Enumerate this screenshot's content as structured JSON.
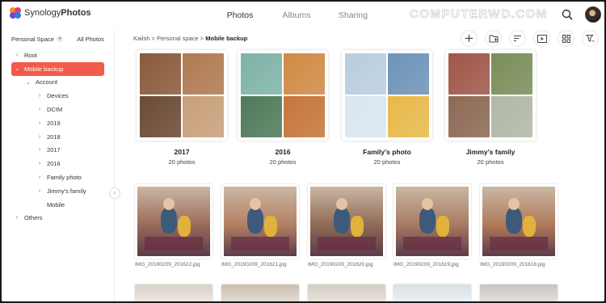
{
  "app": {
    "brand_light": "Synology",
    "brand_bold": "Photos"
  },
  "nav_tabs": [
    {
      "label": "Photos",
      "active": true
    },
    {
      "label": "Albums",
      "active": false
    },
    {
      "label": "Sharing",
      "active": false
    }
  ],
  "watermark": "COMPUTERWD.COM",
  "toolbar_icons": [
    "search-icon",
    "avatar"
  ],
  "sidebar": {
    "space_label": "Personal Space",
    "all_photos": "All Photos",
    "tree": [
      {
        "label": "Root",
        "arrow": "›",
        "depth": 0
      },
      {
        "label": "Mobile backup",
        "arrow": "⌄",
        "depth": 0,
        "selected": true
      },
      {
        "label": "Account",
        "arrow": "⌄",
        "depth": 1
      },
      {
        "label": "Devices",
        "arrow": "›",
        "depth": 2
      },
      {
        "label": "DCIM",
        "arrow": "›",
        "depth": 2
      },
      {
        "label": "2019",
        "arrow": "›",
        "depth": 2
      },
      {
        "label": "2018",
        "arrow": "›",
        "depth": 2
      },
      {
        "label": "2017",
        "arrow": "›",
        "depth": 2
      },
      {
        "label": "2016",
        "arrow": "›",
        "depth": 2
      },
      {
        "label": "Family photo",
        "arrow": "›",
        "depth": 2
      },
      {
        "label": "Jimmy's family",
        "arrow": "›",
        "depth": 2
      },
      {
        "label": "Mobile",
        "arrow": "",
        "depth": 2
      },
      {
        "label": "Others",
        "arrow": "›",
        "depth": 0
      }
    ]
  },
  "breadcrumb": {
    "path": "Kailsh > Personal space > ",
    "current": "Mobile backup"
  },
  "actions": [
    "add-icon",
    "upload-folder-icon",
    "sort-icon",
    "slideshow-icon",
    "grid-view-icon",
    "filter-icon"
  ],
  "albums": [
    {
      "name": "2017",
      "count": "20 photos",
      "colors": [
        "#8a5a3c",
        "#b07a52",
        "#6b4a35",
        "#c8a07a"
      ]
    },
    {
      "name": "2016",
      "count": "20 photos",
      "colors": [
        "#7fb3a8",
        "#d08a45",
        "#4f7a5a",
        "#c5763a"
      ]
    },
    {
      "name": "Family's photo",
      "count": "20 photos",
      "colors": [
        "#b9cde0",
        "#6e94b8",
        "#d9e6f0",
        "#e8b94a"
      ]
    },
    {
      "name": "Jimmy's family",
      "count": "20 photos",
      "colors": [
        "#a0574a",
        "#7a8e5a",
        "#8c6a55",
        "#b0b8a8"
      ]
    }
  ],
  "photos": [
    {
      "name": "IMG_20190209_201622.jpg"
    },
    {
      "name": "IMG_20190209_201621.jpg"
    },
    {
      "name": "IMG_20190209_201620.jpg"
    },
    {
      "name": "IMG_20190209_201619.jpg"
    },
    {
      "name": "IMG_20190209_201618.jpg"
    }
  ],
  "colors": {
    "accent": "#f25b4b"
  }
}
